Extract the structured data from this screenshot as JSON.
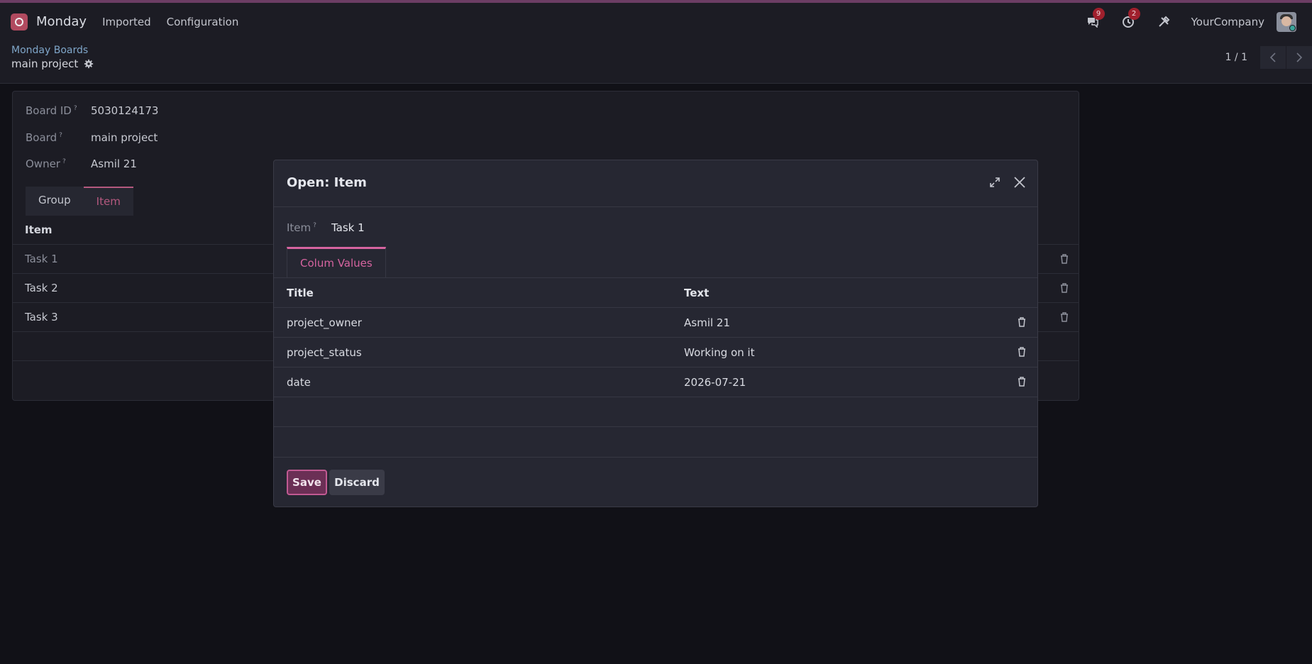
{
  "navbar": {
    "app_name": "Monday",
    "menu": [
      "Imported",
      "Configuration"
    ],
    "messages_badge": "9",
    "activities_badge": "2",
    "company": "YourCompany"
  },
  "control_panel": {
    "breadcrumb": "Monday Boards",
    "record_title": "main project",
    "pager": "1 / 1"
  },
  "form": {
    "fields": [
      {
        "label": "Board ID",
        "help": "?",
        "value": "5030124173"
      },
      {
        "label": "Board",
        "help": "?",
        "value": "main project"
      },
      {
        "label": "Owner",
        "help": "?",
        "value": "Asmil 21"
      }
    ],
    "tabs": [
      "Group",
      "Item"
    ],
    "item_table": {
      "header": "Item",
      "rows": [
        "Task 1",
        "Task 2",
        "Task 3"
      ]
    }
  },
  "modal": {
    "title": "Open: Item",
    "item_label": "Item",
    "item_help": "?",
    "item_value": "Task 1",
    "tab": "Colum Values",
    "columns": [
      "Title",
      "Text"
    ],
    "rows": [
      {
        "title": "project_owner",
        "text": "Asmil 21"
      },
      {
        "title": "project_status",
        "text": "Working on it"
      },
      {
        "title": "date",
        "text": "2026-07-21"
      }
    ],
    "save_label": "Save",
    "discard_label": "Discard"
  },
  "colors": {
    "accent": "#d664a0",
    "background": "#111117",
    "panel": "#1c1c24",
    "modal": "#262732"
  }
}
